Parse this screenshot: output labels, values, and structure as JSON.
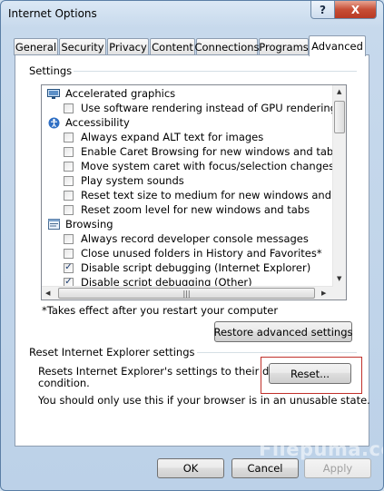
{
  "window": {
    "title": "Internet Options"
  },
  "caption": {
    "help_label": "?",
    "close_label": "X"
  },
  "tabs": [
    {
      "label": "General"
    },
    {
      "label": "Security"
    },
    {
      "label": "Privacy"
    },
    {
      "label": "Content"
    },
    {
      "label": "Connections"
    },
    {
      "label": "Programs"
    },
    {
      "label": "Advanced",
      "selected": true
    }
  ],
  "settings": {
    "group_label": "Settings",
    "items": [
      {
        "type": "category",
        "icon": "monitor-icon",
        "label": "Accelerated graphics"
      },
      {
        "type": "checkbox",
        "label": "Use software rendering instead of GPU rendering*",
        "checked": false
      },
      {
        "type": "category",
        "icon": "accessibility-icon",
        "label": "Accessibility"
      },
      {
        "type": "checkbox",
        "label": "Always expand ALT text for images",
        "checked": false
      },
      {
        "type": "checkbox",
        "label": "Enable Caret Browsing for new windows and tabs",
        "checked": false
      },
      {
        "type": "checkbox",
        "label": "Move system caret with focus/selection changes",
        "checked": false
      },
      {
        "type": "checkbox",
        "label": "Play system sounds",
        "checked": false
      },
      {
        "type": "checkbox",
        "label": "Reset text size to medium for new windows and tabs",
        "checked": false
      },
      {
        "type": "checkbox",
        "label": "Reset zoom level for new windows and tabs",
        "checked": false
      },
      {
        "type": "category",
        "icon": "browsing-icon",
        "label": "Browsing"
      },
      {
        "type": "checkbox",
        "label": "Always record developer console messages",
        "checked": false
      },
      {
        "type": "checkbox",
        "label": "Close unused folders in History and Favorites*",
        "checked": false
      },
      {
        "type": "checkbox",
        "label": "Disable script debugging (Internet Explorer)",
        "checked": true
      },
      {
        "type": "checkbox",
        "label": "Disable script debugging (Other)",
        "checked": true
      }
    ],
    "footnote": "*Takes effect after you restart your computer",
    "restore_button": "Restore advanced settings"
  },
  "reset": {
    "group_label": "Reset Internet Explorer settings",
    "description_line1": "Resets Internet Explorer's settings to their default",
    "description_line2": "condition.",
    "warning": "You should only use this if your browser is in an unusable state.",
    "reset_button": "Reset..."
  },
  "footer": {
    "ok_label": "OK",
    "cancel_label": "Cancel",
    "apply_label": "Apply"
  },
  "watermark": "Filepuma.com",
  "colors": {
    "highlight": "#c0302a",
    "check": "#1a3b6f"
  }
}
